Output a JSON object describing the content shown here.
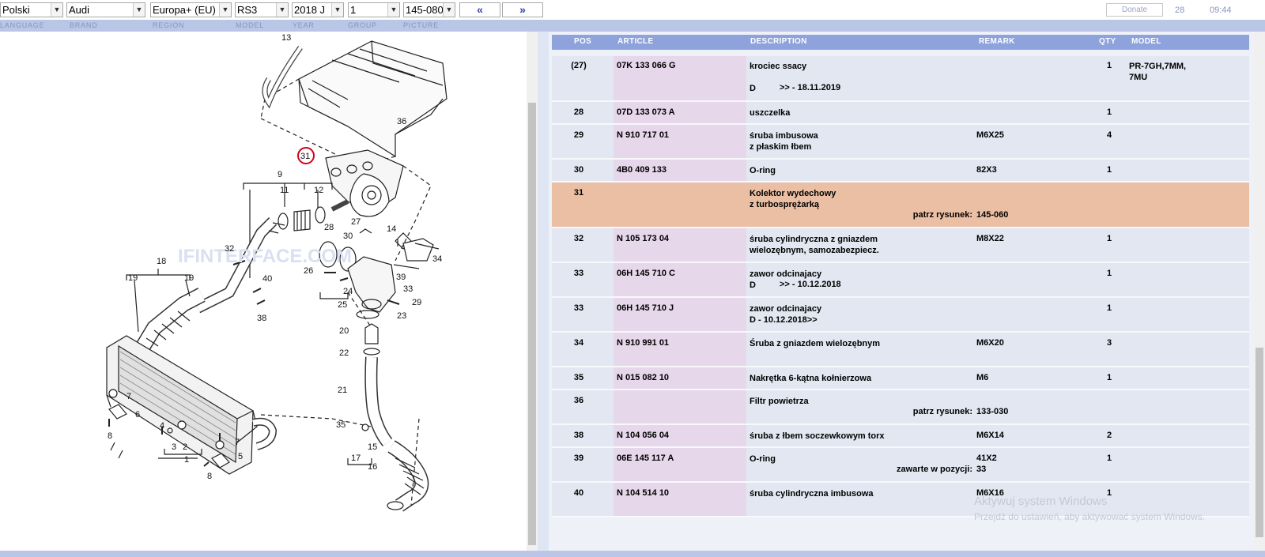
{
  "toolbar": {
    "selects": [
      {
        "id": "language",
        "value": "Polski"
      },
      {
        "id": "brand",
        "value": "Audi"
      },
      {
        "id": "region",
        "value": "Europa+ (EU)"
      },
      {
        "id": "model",
        "value": "RS3"
      },
      {
        "id": "year",
        "value": "2018  J"
      },
      {
        "id": "group",
        "value": "1"
      },
      {
        "id": "picture",
        "value": "145-080"
      }
    ],
    "prev_label": "«",
    "next_label": "»",
    "donate_label": "Donate",
    "count": "28",
    "time": "09:44"
  },
  "labels": [
    "LANGUAGE",
    "BRAND",
    "REGION",
    "MODEL",
    "YEAR",
    "GROUP",
    "PICTURE"
  ],
  "diagram": {
    "watermark": "IFINTERFACE.COM",
    "callouts": [
      "13",
      "36",
      "31",
      "9",
      "11",
      "12",
      "27",
      "28",
      "30",
      "14",
      "32",
      "18",
      "19",
      "19",
      "40",
      "26",
      "24",
      "25",
      "39",
      "33",
      "34",
      "29",
      "38",
      "23",
      "20",
      "22",
      "21",
      "7",
      "6",
      "8",
      "4",
      "3",
      "2",
      "1",
      "7",
      "5",
      "8",
      "35",
      "17",
      "15",
      "16"
    ]
  },
  "table": {
    "headers": {
      "pos": "POS",
      "article": "ARTICLE",
      "description": "DESCRIPTION",
      "remark": "REMARK",
      "qty": "QTY",
      "model": "MODEL"
    },
    "rows": [
      {
        "pos": "(27)",
        "article": "07K 133 066 G",
        "desc": [
          "krociec ssacy"
        ],
        "date_prefix": "D",
        "date": ">> - 18.11.2019",
        "remark": "",
        "qty": "1",
        "model": [
          "PR-7GH,7MM,",
          "7MU"
        ]
      },
      {
        "pos": "28",
        "article": "07D 133 073 A",
        "desc": [
          "uszczelka"
        ],
        "remark": "",
        "qty": "1",
        "model": []
      },
      {
        "pos": "29",
        "article": "N  910 717 01",
        "desc": [
          "śruba imbusowa",
          "z płaskim łbem"
        ],
        "remark": "M6X25",
        "qty": "4",
        "model": []
      },
      {
        "pos": "30",
        "article": "4B0 409 133",
        "desc": [
          "O-ring"
        ],
        "remark": "82X3",
        "qty": "1",
        "model": []
      },
      {
        "pos": "31",
        "article": "",
        "desc": [
          "Kolektor wydechowy",
          "z turbosprężarką"
        ],
        "note_label": "patrz rysunek:",
        "note_value": "145-060",
        "remark": "",
        "qty": "",
        "model": [],
        "highlight": true
      },
      {
        "pos": "32",
        "article": "N  105 173 04",
        "desc": [
          "śruba cylindryczna z gniazdem",
          "wielozębnym, samozabezpiecz."
        ],
        "remark": "M8X22",
        "qty": "1",
        "model": []
      },
      {
        "pos": "33",
        "article": "06H 145 710 C",
        "desc": [
          "zawor odcinajacy"
        ],
        "date_prefix": "D",
        "date": ">> - 10.12.2018",
        "remark": "",
        "qty": "1",
        "model": []
      },
      {
        "pos": "33",
        "article": "06H 145 710 J",
        "desc": [
          "zawor odcinajacy",
          "D - 10.12.2018>>"
        ],
        "remark": "",
        "qty": "1",
        "model": []
      },
      {
        "pos": "34",
        "article": "N  910 991 01",
        "desc": [
          "Śruba z gniazdem wielozębnym"
        ],
        "remark": "M6X20",
        "qty": "3",
        "model": []
      },
      {
        "pos": "35",
        "article": "N  015 082 10",
        "desc": [
          "Nakrętka 6-kątna kołnierzowa"
        ],
        "remark": "M6",
        "qty": "1",
        "model": []
      },
      {
        "pos": "36",
        "article": "",
        "desc": [
          "Filtr powietrza"
        ],
        "note_label": "patrz rysunek:",
        "note_value": "133-030",
        "remark": "",
        "qty": "",
        "model": []
      },
      {
        "pos": "38",
        "article": "N  104 056 04",
        "desc": [
          "śruba z łbem soczewkowym torx"
        ],
        "remark": "M6X14",
        "qty": "2",
        "model": []
      },
      {
        "pos": "39",
        "article": "06E 145 117 A",
        "desc": [
          "O-ring"
        ],
        "note_label": "zawarte w pozycji:",
        "note_value": "33",
        "remark": "41X2",
        "qty": "1",
        "model": []
      },
      {
        "pos": "40",
        "article": "N  104 514 10",
        "desc": [
          "śruba cylindryczna imbusowa"
        ],
        "remark": "M6X16",
        "qty": "1",
        "model": []
      }
    ]
  },
  "overlay": {
    "line1": "Aktywuj system Windows",
    "line2": "Przejdź do ustawień, aby aktywować system Windows."
  },
  "colors": {
    "header": "#8ea2dc",
    "highlight": "#ebbfa4",
    "article_bg": "#e6d7ea",
    "row_bg": "#e2e7f1",
    "callout_circle": "#d0021b"
  }
}
